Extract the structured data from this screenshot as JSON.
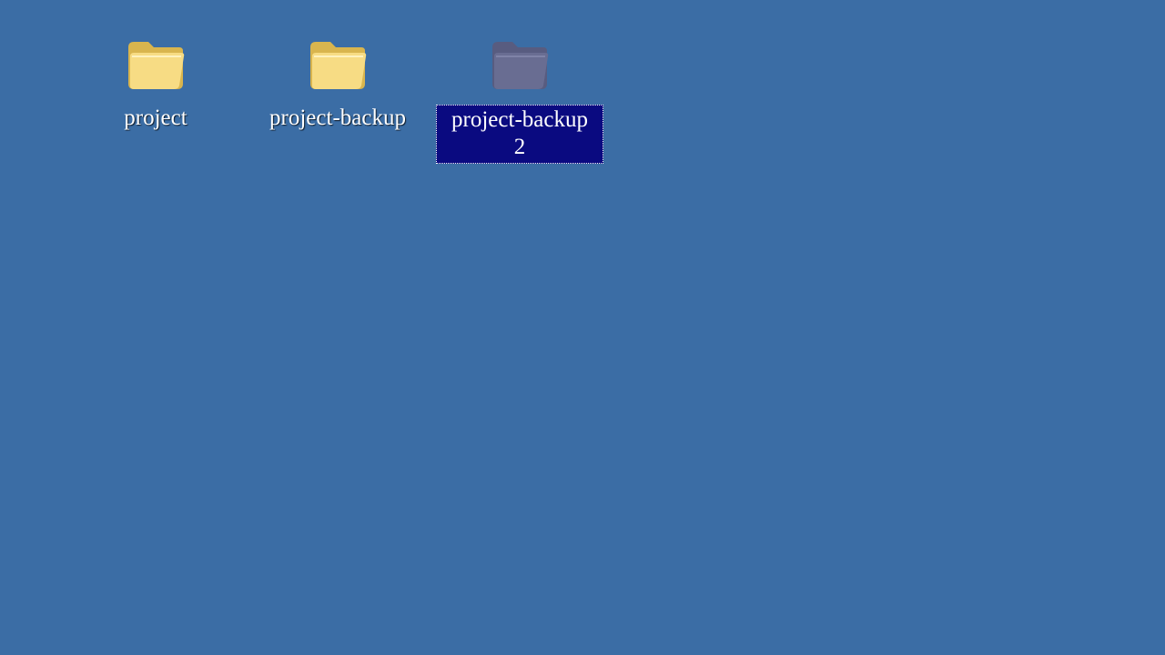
{
  "desktop": {
    "background_color": "#3B6DA5",
    "icons": [
      {
        "label": "project",
        "icon": "folder-icon",
        "selected": false
      },
      {
        "label": "project-backup",
        "icon": "folder-icon",
        "selected": false
      },
      {
        "label_line1": "project-backup",
        "label_line2": "2",
        "icon": "folder-icon",
        "selected": true
      }
    ]
  },
  "colors": {
    "folder_yellow": "#F5D77A",
    "folder_selected": "#6F6A8C",
    "selection_bg": "#0A0A80"
  }
}
